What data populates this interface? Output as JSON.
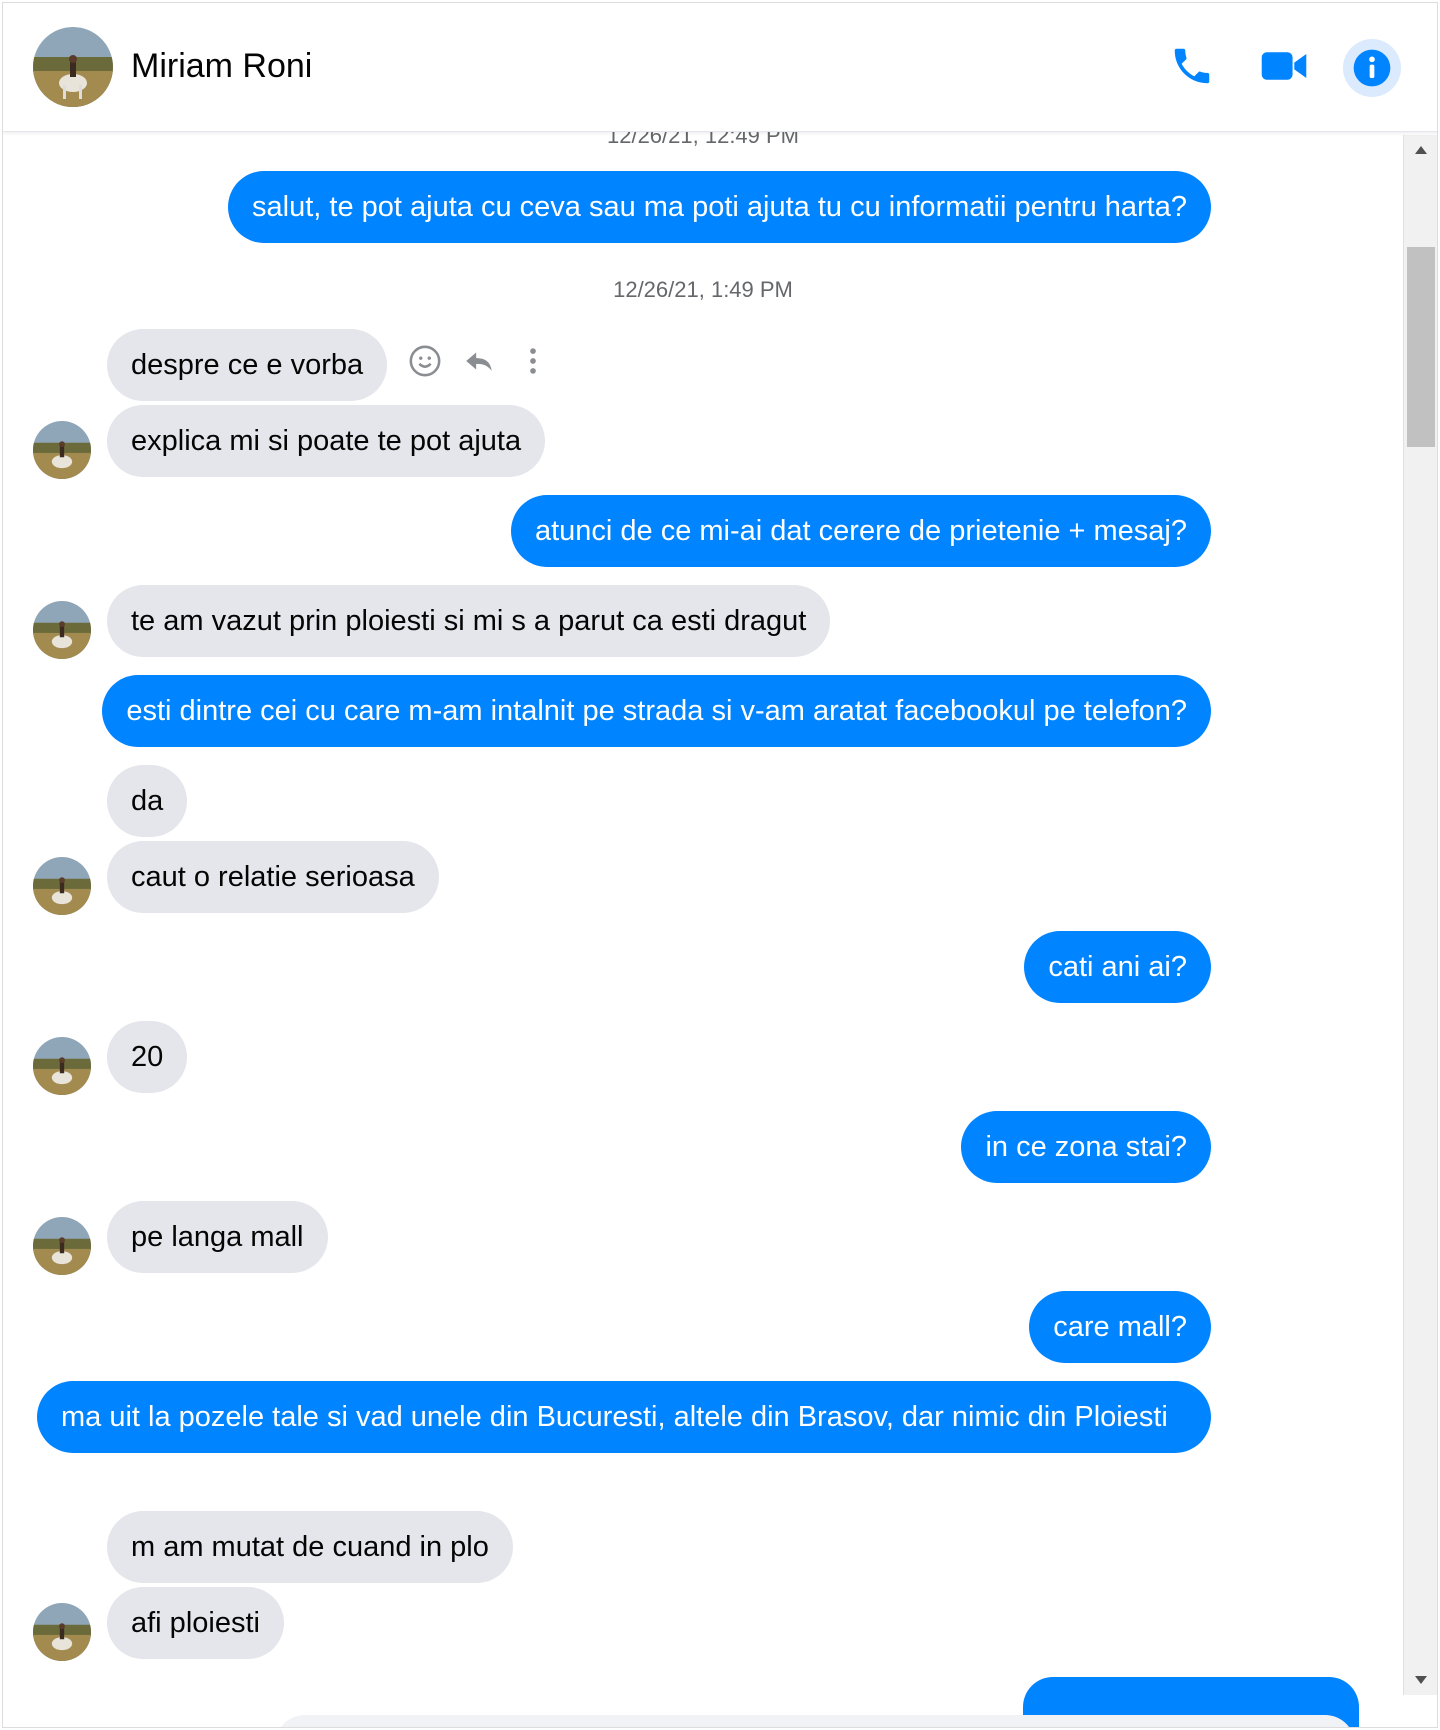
{
  "header": {
    "contact_name": "Miriam Roni",
    "icons": [
      "phone-icon",
      "video-icon",
      "info-icon"
    ],
    "accent": "#0084ff"
  },
  "timestamps": {
    "top_cut": "12/26/21, 12:49 PM",
    "second": "12/26/21, 1:49 PM"
  },
  "messages": [
    {
      "dir": "out",
      "text": "salut, te pot ajuta cu ceva sau ma poti ajuta tu cu informatii pentru harta?"
    },
    {
      "dir": "in",
      "text": "despre ce e vorba"
    },
    {
      "dir": "in",
      "text": "explica mi si poate te pot ajuta"
    },
    {
      "dir": "out",
      "text": "atunci de ce mi-ai dat cerere de prietenie + mesaj?"
    },
    {
      "dir": "in",
      "text": "te am vazut prin ploiesti si mi s a parut ca esti dragut"
    },
    {
      "dir": "out",
      "text": "esti dintre cei cu care m-am intalnit pe strada si v-am aratat facebookul pe telefon?"
    },
    {
      "dir": "in",
      "text": "da"
    },
    {
      "dir": "in",
      "text": "caut o relatie serioasa"
    },
    {
      "dir": "out",
      "text": "cati ani ai?"
    },
    {
      "dir": "in",
      "text": "20"
    },
    {
      "dir": "out",
      "text": "in ce zona stai?"
    },
    {
      "dir": "in",
      "text": "pe langa mall"
    },
    {
      "dir": "out",
      "text": "care mall?"
    },
    {
      "dir": "out",
      "text": "ma uit la pozele tale si vad unele din Bucuresti, altele din Brasov, dar nimic din Ploiesti"
    },
    {
      "dir": "in",
      "text": "m am mutat de cuand in plo"
    },
    {
      "dir": "in",
      "text": "afi ploiesti"
    }
  ],
  "hover_actions": [
    "smiley-icon",
    "reply-icon",
    "more-icon"
  ],
  "colors": {
    "outgoing": "#0084ff",
    "incoming": "#e4e6eb",
    "timestamp": "#65676b"
  }
}
